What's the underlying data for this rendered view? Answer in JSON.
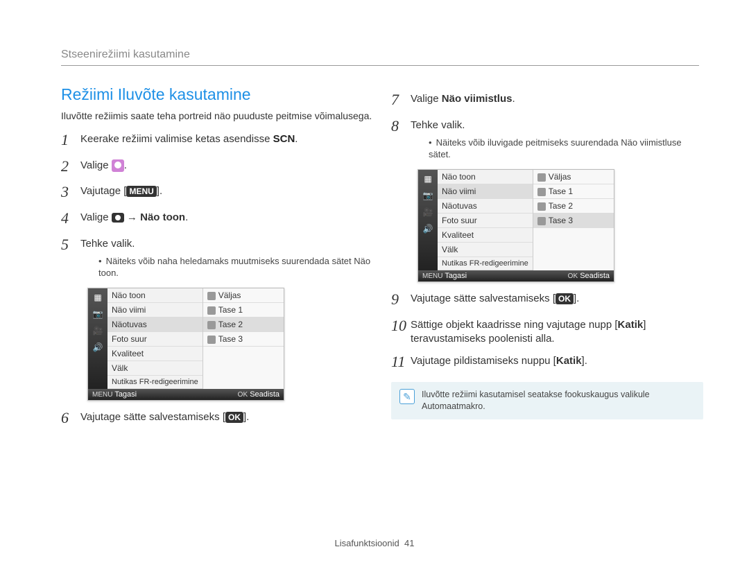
{
  "header": {
    "title": "Stseenirežiimi kasutamine"
  },
  "section": {
    "title": "Režiimi Iluvõte kasutamine",
    "intro": "Iluvõtte režiimis saate teha portreid näo puuduste peitmise võimalusega."
  },
  "steps_left": {
    "s1_a": "Keerake režiimi valimise ketas asendisse ",
    "s1_scn": "SCN",
    "s1_b": ".",
    "s2_a": "Valige ",
    "s2_b": ".",
    "s3_a": "Vajutage [",
    "s3_menu": "MENU",
    "s3_b": "].",
    "s4_a": "Valige ",
    "s4_arrow": " → ",
    "s4_bold": "Näo toon",
    "s4_b": ".",
    "s5": "Tehke valik.",
    "s5_sub": "Näiteks võib naha heledamaks muutmiseks suurendada sätet Näo toon.",
    "s6_a": "Vajutage sätte salvestamiseks [",
    "s6_ok": "OK",
    "s6_b": "]."
  },
  "steps_right": {
    "s7_a": "Valige ",
    "s7_bold": "Näo viimistlus",
    "s7_b": ".",
    "s8": "Tehke valik.",
    "s8_sub": "Näiteks võib iluvigade peitmiseks suurendada Näo viimistluse sätet.",
    "s9_a": "Vajutage sätte salvestamiseks [",
    "s9_ok": "OK",
    "s9_b": "].",
    "s10_a": "Sättige objekt kaadrisse ning vajutage nupp [",
    "s10_bold": "Katik",
    "s10_b": "] teravustamiseks pooleni​sti alla.",
    "s11_a": "Vajutage pildistamiseks nuppu [",
    "s11_bold": "Katik",
    "s11_b": "]."
  },
  "lcd1": {
    "menu": [
      "Näo toon",
      "Näo viimi",
      "Näotuvas",
      "Foto suur",
      "Kvaliteet",
      "Välk",
      "Nutikas FR-redigeerimine"
    ],
    "sel_menu": "Näotuvas",
    "opts": [
      "Väljas",
      "Tase 1",
      "Tase 2",
      "Tase 3"
    ],
    "sel_opt": "Tase 2",
    "back": "Tagasi",
    "set": "Seadista",
    "menu_lbl": "MENU",
    "ok_lbl": "OK"
  },
  "lcd2": {
    "menu": [
      "Näo toon",
      "Näo viimi",
      "Näotuvas",
      "Foto suur",
      "Kvaliteet",
      "Välk",
      "Nutikas FR-redigeerimine"
    ],
    "sel_menu": "Näo viimi",
    "opts": [
      "Väljas",
      "Tase 1",
      "Tase 2",
      "Tase 3"
    ],
    "sel_opt": "Tase 3",
    "back": "Tagasi",
    "set": "Seadista",
    "menu_lbl": "MENU",
    "ok_lbl": "OK"
  },
  "note": "Iluvõtte režiimi kasutamisel seatakse fookuskaugus valikule Automaatmakro.",
  "footer": {
    "label": "Lisafunktsioonid",
    "page": "41"
  }
}
